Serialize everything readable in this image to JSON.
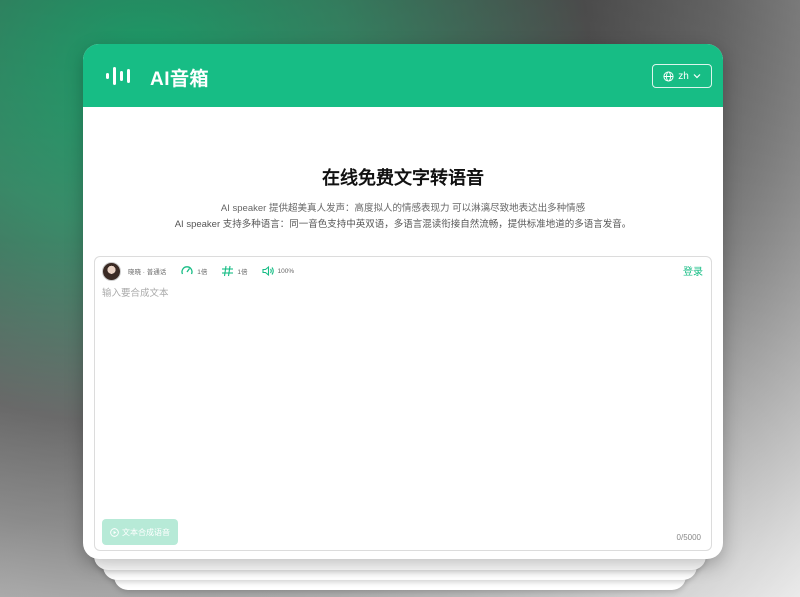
{
  "app": {
    "title": "AI音箱",
    "language_button": "zh"
  },
  "hero": {
    "title": "在线免费文字转语音",
    "description_line_1": "AI speaker 提供超美真人发声：高度拟人的情感表现力 可以淋漓尽致地表达出多种情感",
    "description_line_2": "AI speaker 支持多种语言：同一音色支持中英双语，多语言混读衔接自然流畅，提供标准地道的多语言发音。"
  },
  "editor": {
    "voice_name": "晓晓 · 普通话",
    "speed_label": "1倍",
    "pitch_label": "1倍",
    "volume_label": "100%",
    "login_label": "登录",
    "input_placeholder": "输入要合成文本",
    "input_value": "",
    "synthesize_button": "文本合成语音",
    "char_count": "0/5000"
  },
  "colors": {
    "brand": "#17bd85",
    "button_disabled": "#b7ead7"
  },
  "icons": {
    "logo": "sound-wave-icon",
    "language": "globe-icon",
    "dropdown": "chevron-down-icon",
    "speed": "speedometer-icon",
    "pitch": "pitch-icon",
    "volume": "speaker-icon",
    "synthesize": "play-circle-icon"
  }
}
